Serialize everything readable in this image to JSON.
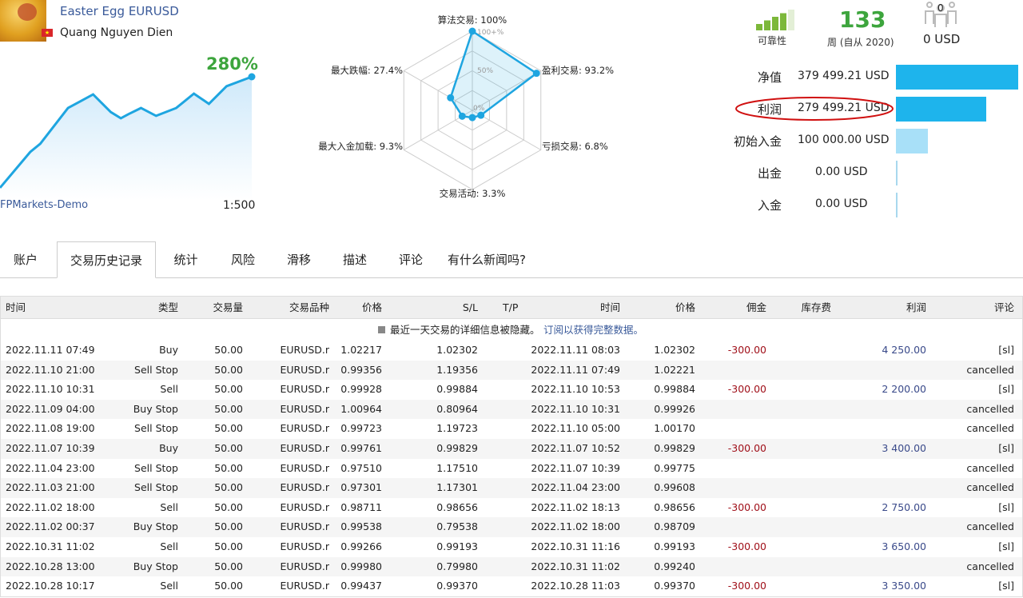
{
  "signal": {
    "title": "Easter Egg EURUSD",
    "author": "Quang Nguyen Dien",
    "gain": "280%",
    "server": "FPMarkets-Demo",
    "leverage": "1:500"
  },
  "equity_curve": {
    "type": "line",
    "x": [
      0,
      12,
      16,
      27,
      37,
      44,
      48,
      51,
      56,
      62,
      70,
      77,
      83,
      90,
      100
    ],
    "values": [
      10,
      97,
      117,
      204,
      237,
      194,
      179,
      189,
      204,
      185,
      204,
      239,
      214,
      257,
      280
    ]
  },
  "radar": {
    "type": "radar",
    "scale_labels": [
      "100+%",
      "50%",
      "0%"
    ],
    "axes": [
      {
        "label": "算法交易: 100%",
        "value": 100
      },
      {
        "label": "盈利交易: 93.2%",
        "value": 93.2
      },
      {
        "label": "亏损交易: 6.8%",
        "value": 6.8
      },
      {
        "label": "交易活动: 3.3%",
        "value": 3.3
      },
      {
        "label": "最大入金加载: 9.3%",
        "value": 9.3
      },
      {
        "label": "最大跌幅: 27.4%",
        "value": 27.4
      }
    ],
    "color": "#1ea5e0"
  },
  "stats": {
    "reliability_label": "可靠性",
    "reliability_bars": 4,
    "weeks": "133",
    "weeks_label": "周 (自从 2020)",
    "subscribers": "0",
    "subscribers_usd": "0 USD"
  },
  "finance": [
    {
      "label": "净值",
      "value": "379 499.21 USD",
      "amount": 379499.21,
      "color": "#1eb4ec"
    },
    {
      "label": "利润",
      "value": "279 499.21 USD",
      "amount": 279499.21,
      "color": "#1eb4ec"
    },
    {
      "label": "初始入金",
      "value": "100 000.00 USD",
      "amount": 100000,
      "color": "#a8e0f8"
    },
    {
      "label": "出金",
      "value": "0.00 USD",
      "amount": 0,
      "color": "#a8d8ee"
    },
    {
      "label": "入金",
      "value": "0.00 USD",
      "amount": 0,
      "color": "#a8d8ee"
    }
  ],
  "tabs": [
    "账户",
    "交易历史记录",
    "统计",
    "风险",
    "滑移",
    "描述",
    "评论",
    "有什么新闻吗?"
  ],
  "active_tab": 1,
  "table": {
    "headers": [
      "时间",
      "类型",
      "交易量",
      "交易品种",
      "价格",
      "S/L",
      "T/P",
      "时间",
      "价格",
      "佣金",
      "库存费",
      "利润",
      "评论"
    ],
    "notice": "最近一天交易的详细信息被隐藏。",
    "notice_link": "订阅以获得完整数据。",
    "rows": [
      [
        "2022.11.11 07:49",
        "Buy",
        "50.00",
        "EURUSD.r",
        "1.02217",
        "1.02302",
        "",
        "2022.11.11 08:03",
        "1.02302",
        "-300.00",
        "",
        "4 250.00",
        "[sl]"
      ],
      [
        "2022.11.10 21:00",
        "Sell Stop",
        "50.00",
        "EURUSD.r",
        "0.99356",
        "1.19356",
        "",
        "2022.11.11 07:49",
        "1.02221",
        "",
        "",
        "",
        "cancelled"
      ],
      [
        "2022.11.10 10:31",
        "Sell",
        "50.00",
        "EURUSD.r",
        "0.99928",
        "0.99884",
        "",
        "2022.11.10 10:53",
        "0.99884",
        "-300.00",
        "",
        "2 200.00",
        "[sl]"
      ],
      [
        "2022.11.09 04:00",
        "Buy Stop",
        "50.00",
        "EURUSD.r",
        "1.00964",
        "0.80964",
        "",
        "2022.11.10 10:31",
        "0.99926",
        "",
        "",
        "",
        "cancelled"
      ],
      [
        "2022.11.08 19:00",
        "Sell Stop",
        "50.00",
        "EURUSD.r",
        "0.99723",
        "1.19723",
        "",
        "2022.11.10 05:00",
        "1.00170",
        "",
        "",
        "",
        "cancelled"
      ],
      [
        "2022.11.07 10:39",
        "Buy",
        "50.00",
        "EURUSD.r",
        "0.99761",
        "0.99829",
        "",
        "2022.11.07 10:52",
        "0.99829",
        "-300.00",
        "",
        "3 400.00",
        "[sl]"
      ],
      [
        "2022.11.04 23:00",
        "Sell Stop",
        "50.00",
        "EURUSD.r",
        "0.97510",
        "1.17510",
        "",
        "2022.11.07 10:39",
        "0.99775",
        "",
        "",
        "",
        "cancelled"
      ],
      [
        "2022.11.03 21:00",
        "Sell Stop",
        "50.00",
        "EURUSD.r",
        "0.97301",
        "1.17301",
        "",
        "2022.11.04 23:00",
        "0.99608",
        "",
        "",
        "",
        "cancelled"
      ],
      [
        "2022.11.02 18:00",
        "Sell",
        "50.00",
        "EURUSD.r",
        "0.98711",
        "0.98656",
        "",
        "2022.11.02 18:13",
        "0.98656",
        "-300.00",
        "",
        "2 750.00",
        "[sl]"
      ],
      [
        "2022.11.02 00:37",
        "Buy Stop",
        "50.00",
        "EURUSD.r",
        "0.99538",
        "0.79538",
        "",
        "2022.11.02 18:00",
        "0.98709",
        "",
        "",
        "",
        "cancelled"
      ],
      [
        "2022.10.31 11:02",
        "Sell",
        "50.00",
        "EURUSD.r",
        "0.99266",
        "0.99193",
        "",
        "2022.10.31 11:16",
        "0.99193",
        "-300.00",
        "",
        "3 650.00",
        "[sl]"
      ],
      [
        "2022.10.28 13:00",
        "Buy Stop",
        "50.00",
        "EURUSD.r",
        "0.99980",
        "0.79980",
        "",
        "2022.10.31 11:02",
        "0.99240",
        "",
        "",
        "",
        "cancelled"
      ],
      [
        "2022.10.28 10:17",
        "Sell",
        "50.00",
        "EURUSD.r",
        "0.99437",
        "0.99370",
        "",
        "2022.10.28 11:03",
        "0.99370",
        "-300.00",
        "",
        "3 350.00",
        "[sl]"
      ]
    ]
  }
}
